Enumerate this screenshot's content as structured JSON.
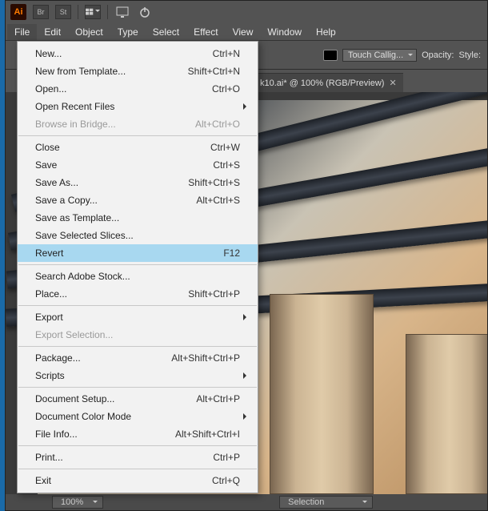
{
  "titlebar": {
    "logo_text": "Ai",
    "buttons": {
      "br": "Br",
      "st": "St"
    }
  },
  "menubar": {
    "items": [
      "File",
      "Edit",
      "Object",
      "Type",
      "Select",
      "Effect",
      "View",
      "Window",
      "Help"
    ],
    "open_index": 0
  },
  "controlbar": {
    "brush_label": "Touch Callig...",
    "opacity_label": "Opacity:",
    "style_label": "Style:"
  },
  "tabbar": {
    "title": "k10.ai* @ 100% (RGB/Preview)"
  },
  "statusbar": {
    "zoom": "100%",
    "mode": "Selection"
  },
  "file_menu": {
    "items": [
      {
        "label": "New...",
        "shortcut": "Ctrl+N",
        "type": "item"
      },
      {
        "label": "New from Template...",
        "shortcut": "Shift+Ctrl+N",
        "type": "item"
      },
      {
        "label": "Open...",
        "shortcut": "Ctrl+O",
        "type": "item"
      },
      {
        "label": "Open Recent Files",
        "shortcut": "",
        "type": "submenu"
      },
      {
        "label": "Browse in Bridge...",
        "shortcut": "Alt+Ctrl+O",
        "type": "item",
        "disabled": true
      },
      {
        "type": "sep"
      },
      {
        "label": "Close",
        "shortcut": "Ctrl+W",
        "type": "item"
      },
      {
        "label": "Save",
        "shortcut": "Ctrl+S",
        "type": "item"
      },
      {
        "label": "Save As...",
        "shortcut": "Shift+Ctrl+S",
        "type": "item"
      },
      {
        "label": "Save a Copy...",
        "shortcut": "Alt+Ctrl+S",
        "type": "item"
      },
      {
        "label": "Save as Template...",
        "shortcut": "",
        "type": "item"
      },
      {
        "label": "Save Selected Slices...",
        "shortcut": "",
        "type": "item"
      },
      {
        "label": "Revert",
        "shortcut": "F12",
        "type": "item",
        "highlight": true
      },
      {
        "type": "sep"
      },
      {
        "label": "Search Adobe Stock...",
        "shortcut": "",
        "type": "item"
      },
      {
        "label": "Place...",
        "shortcut": "Shift+Ctrl+P",
        "type": "item"
      },
      {
        "type": "sep"
      },
      {
        "label": "Export",
        "shortcut": "",
        "type": "submenu"
      },
      {
        "label": "Export Selection...",
        "shortcut": "",
        "type": "item",
        "disabled": true
      },
      {
        "type": "sep"
      },
      {
        "label": "Package...",
        "shortcut": "Alt+Shift+Ctrl+P",
        "type": "item"
      },
      {
        "label": "Scripts",
        "shortcut": "",
        "type": "submenu"
      },
      {
        "type": "sep"
      },
      {
        "label": "Document Setup...",
        "shortcut": "Alt+Ctrl+P",
        "type": "item"
      },
      {
        "label": "Document Color Mode",
        "shortcut": "",
        "type": "submenu"
      },
      {
        "label": "File Info...",
        "shortcut": "Alt+Shift+Ctrl+I",
        "type": "item"
      },
      {
        "type": "sep"
      },
      {
        "label": "Print...",
        "shortcut": "Ctrl+P",
        "type": "item"
      },
      {
        "type": "sep"
      },
      {
        "label": "Exit",
        "shortcut": "Ctrl+Q",
        "type": "item"
      }
    ]
  }
}
